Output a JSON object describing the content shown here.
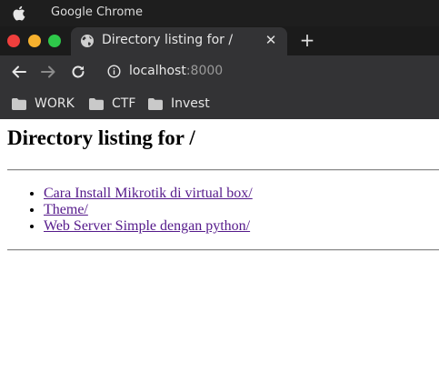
{
  "os": {
    "app_name": "Google Chrome"
  },
  "tab": {
    "title": "Directory listing for /",
    "close_glyph": "✕"
  },
  "new_tab_glyph": "+",
  "address": {
    "host": "localhost",
    "port": ":8000"
  },
  "bookmarks": [
    {
      "label": "WORK",
      "icon": "folder-icon"
    },
    {
      "label": "CTF",
      "icon": "folder-icon"
    },
    {
      "label": "Invest",
      "icon": "folder-icon"
    }
  ],
  "page": {
    "heading": "Directory listing for /",
    "entries": [
      {
        "label": "Cara Install Mikrotik di virtual box/"
      },
      {
        "label": "Theme/"
      },
      {
        "label": "Web Server Simple dengan python/"
      }
    ]
  },
  "colors": {
    "traffic_red": "#ef3f3d",
    "traffic_yellow": "#f6b12e",
    "traffic_green": "#2ec84a",
    "link_visited": "#551a8b"
  }
}
